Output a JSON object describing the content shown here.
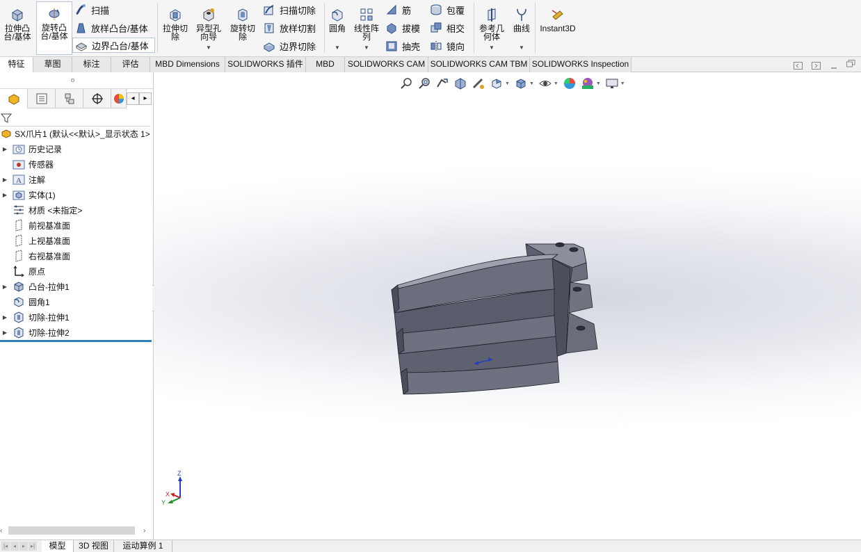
{
  "ribbon": {
    "extrude_boss": "拉伸凸\n台/基体",
    "revolve_boss": "旋转凸\n台/基体",
    "sweep": "扫描",
    "loft_boss": "放样凸台/基体",
    "boundary_boss": "边界凸台/基体",
    "extrude_cut": "拉伸切\n除",
    "hole_wizard": "异型孔\n向导",
    "revolve_cut": "旋转切\n除",
    "swept_cut": "扫描切除",
    "lofted_cut": "放样切割",
    "boundary_cut": "边界切除",
    "fillet": "圆角",
    "linear_pattern": "线性阵\n列",
    "rib": "筋",
    "draft": "拔模",
    "shell": "抽壳",
    "wrap": "包覆",
    "intersect": "相交",
    "mirror": "镜向",
    "ref_geometry": "参考几\n何体",
    "curves": "曲线",
    "instant3d": "Instant3D"
  },
  "tabs": [
    "特征",
    "草图",
    "标注",
    "评估",
    "MBD Dimensions",
    "SOLIDWORKS 插件",
    "MBD",
    "SOLIDWORKS CAM",
    "SOLIDWORKS CAM TBM",
    "SOLIDWORKS Inspection"
  ],
  "tree": {
    "root": "SX爪片1 (默认<<默认>_显示状态 1>",
    "items": [
      {
        "label": "历史记录",
        "icon": "history-folder-icon"
      },
      {
        "label": "传感器",
        "icon": "sensor-icon"
      },
      {
        "label": "注解",
        "icon": "annotation-icon"
      },
      {
        "label": "实体(1)",
        "icon": "solid-bodies-icon"
      },
      {
        "label": "材质 <未指定>",
        "icon": "material-icon"
      },
      {
        "label": "前视基准面",
        "icon": "plane-icon"
      },
      {
        "label": "上视基准面",
        "icon": "plane-icon"
      },
      {
        "label": "右视基准面",
        "icon": "plane-icon"
      },
      {
        "label": "原点",
        "icon": "origin-icon"
      },
      {
        "label": "凸台-拉伸1",
        "icon": "boss-extrude-icon"
      },
      {
        "label": "圆角1",
        "icon": "fillet-feature-icon"
      },
      {
        "label": "切除-拉伸1",
        "icon": "cut-extrude-icon"
      },
      {
        "label": "切除-拉伸2",
        "icon": "cut-extrude-icon"
      }
    ]
  },
  "triad": {
    "x": "X",
    "y": "Y",
    "z": "Z"
  },
  "bottom_tabs": [
    "模型",
    "3D 视图",
    "运动算例 1"
  ],
  "colors": {
    "accent": "#2f7fbd",
    "part": "#6e7282",
    "part_top": "#9a9eac"
  }
}
